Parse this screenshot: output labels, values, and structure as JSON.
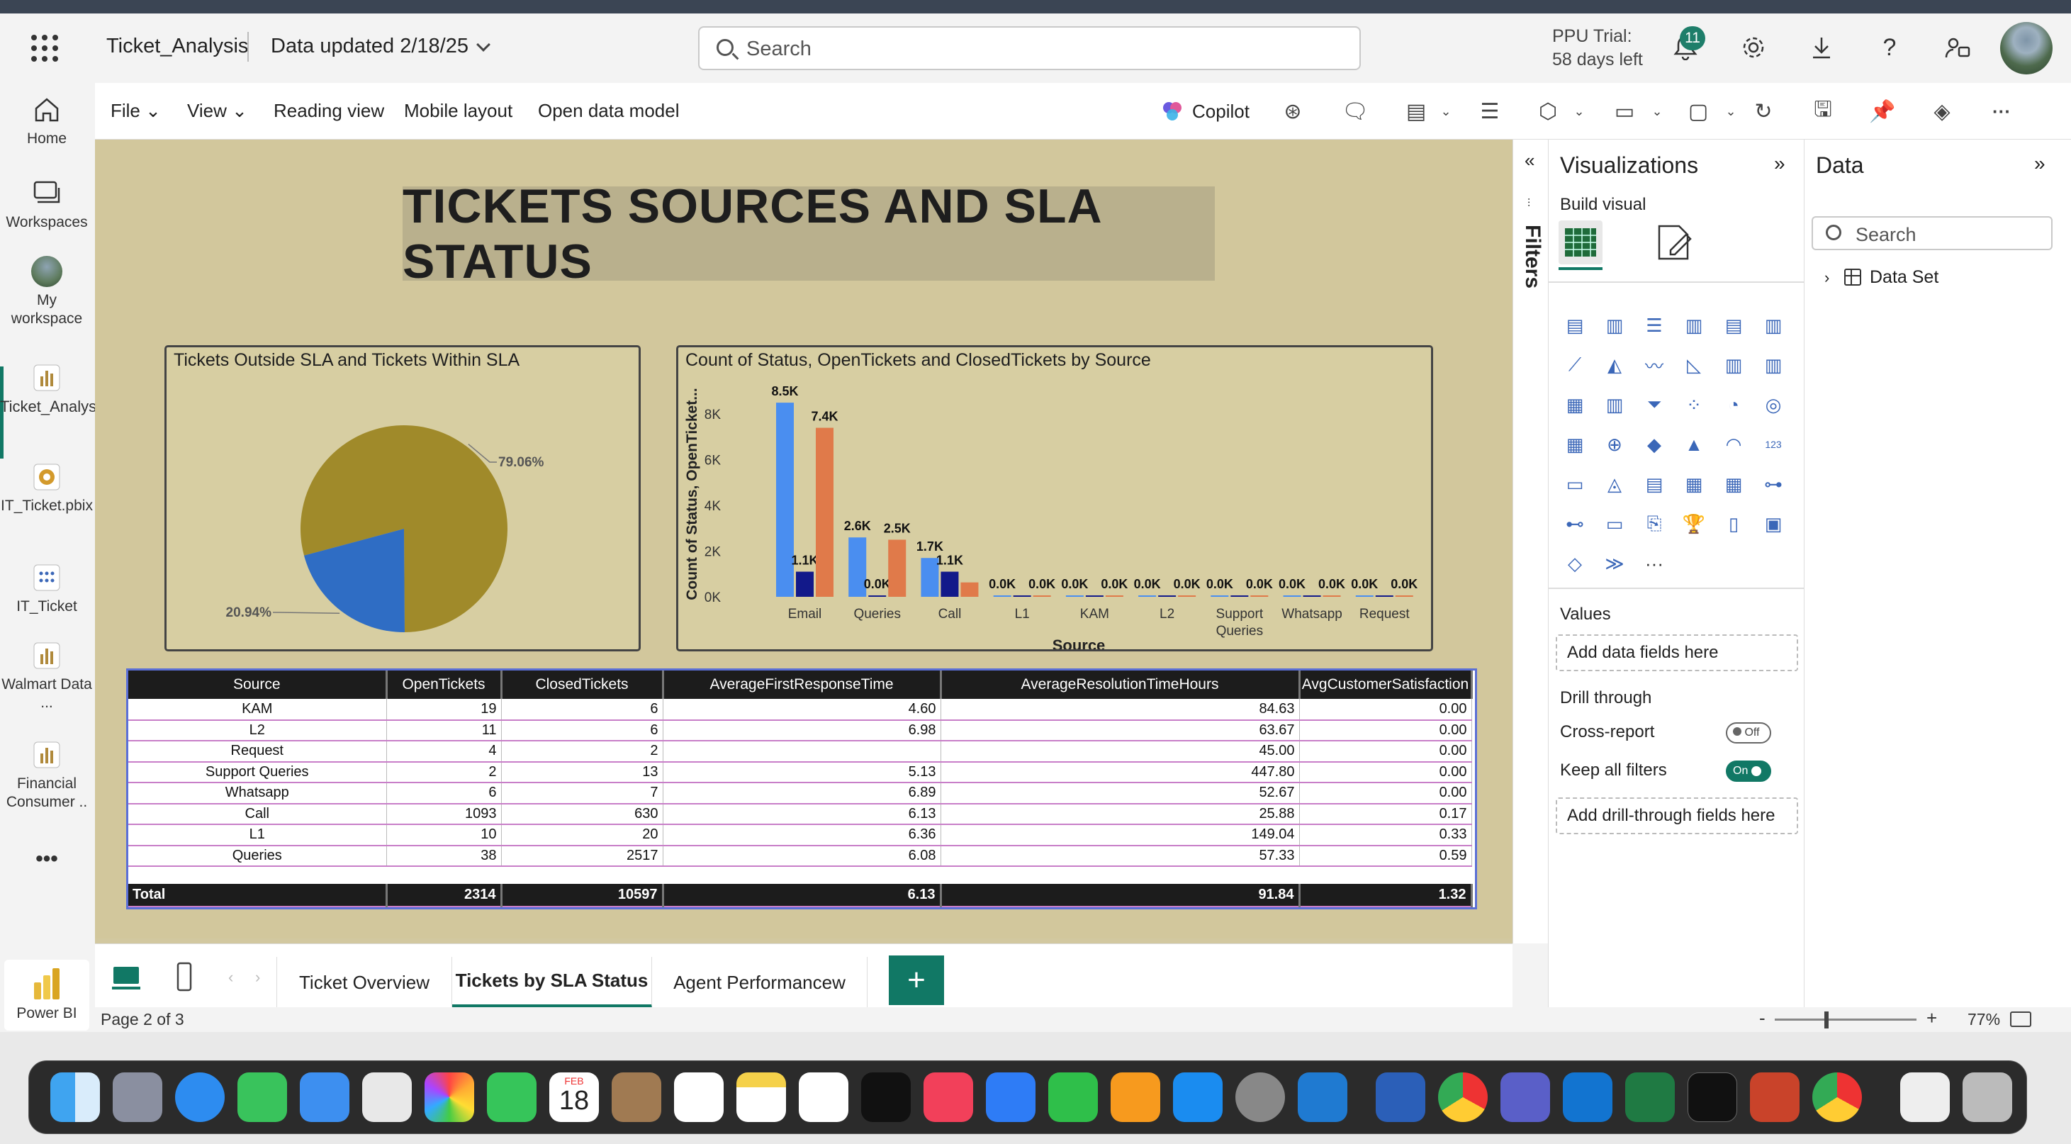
{
  "topbar": {
    "app_title": "Ticket_Analysis",
    "data_updated": "Data updated 2/18/25",
    "search_placeholder": "Search",
    "ppu_line1": "PPU Trial:",
    "ppu_line2": "58 days left",
    "notif_count": "11"
  },
  "leftnav": {
    "items": [
      {
        "label": "Home",
        "icon": "home-icon"
      },
      {
        "label": "Workspaces",
        "icon": "workspaces-icon"
      },
      {
        "label": "My workspace",
        "icon": "avatar"
      },
      {
        "label": "Ticket_Analysis",
        "icon": "report-icon"
      },
      {
        "label": "IT_Ticket.pbix",
        "icon": "pbix-icon"
      },
      {
        "label": "IT_Ticket",
        "icon": "dataset-icon"
      },
      {
        "label": "Walmart Data ...",
        "icon": "report-icon"
      },
      {
        "label": "Financial Consumer ..",
        "icon": "report-icon"
      }
    ],
    "more": "•••",
    "brand": "Power BI"
  },
  "menubar": {
    "file": "File",
    "view": "View",
    "reading_view": "Reading view",
    "mobile_layout": "Mobile layout",
    "open_data_model": "Open data model",
    "copilot": "Copilot"
  },
  "report": {
    "title": "TICKETS SOURCES AND SLA STATUS"
  },
  "chart_data": [
    {
      "type": "pie",
      "title": "Tickets Outside SLA and Tickets Within SLA",
      "slices": [
        {
          "value": 79.06,
          "label": "79.06%",
          "color": "#a08a2a"
        },
        {
          "value": 20.94,
          "label": "20.94%",
          "color": "#2f6dc4"
        }
      ]
    },
    {
      "type": "bar",
      "title": "Count of Status, OpenTickets and ClosedTickets by Source",
      "xlabel": "Source",
      "ylabel": "Count of Status, OpenTicket...",
      "ylim": [
        0,
        9000
      ],
      "yticks": [
        "0K",
        "2K",
        "4K",
        "6K",
        "8K"
      ],
      "categories": [
        "Email",
        "Queries",
        "Call",
        "L1",
        "KAM",
        "L2",
        "Support Queries",
        "Whatsapp",
        "Request"
      ],
      "series": [
        {
          "color": "#4a8ef0",
          "values": [
            8500,
            2600,
            1700,
            30,
            25,
            17,
            15,
            13,
            6
          ],
          "labels": [
            "8.5K",
            "2.6K",
            "1.7K",
            "0.0K",
            "0.0K",
            "0.0K",
            "0.0K",
            "0.0K",
            "0.0K"
          ]
        },
        {
          "color": "#12198a",
          "values": [
            1100,
            38,
            1100,
            10,
            19,
            11,
            2,
            6,
            4
          ],
          "labels": [
            "1.1K",
            "0.0K",
            "1.1K",
            "",
            "",
            "",
            "",
            "",
            ""
          ]
        },
        {
          "color": "#e07a4a",
          "values": [
            7400,
            2500,
            630,
            20,
            6,
            6,
            13,
            7,
            2
          ],
          "labels": [
            "7.4K",
            "2.5K",
            "",
            "0.0K",
            "0.0K",
            "0.0K",
            "0.0K",
            "0.0K",
            "0.0K"
          ]
        }
      ]
    }
  ],
  "table": {
    "headers": [
      "Source",
      "OpenTickets",
      "ClosedTickets",
      "AverageFirstResponseTime",
      "AverageResolutionTimeHours",
      "AvgCustomerSatisfaction"
    ],
    "rows": [
      [
        "KAM",
        "19",
        "6",
        "4.60",
        "84.63",
        "0.00"
      ],
      [
        "L2",
        "11",
        "6",
        "6.98",
        "63.67",
        "0.00"
      ],
      [
        "Request",
        "4",
        "2",
        "",
        "45.00",
        "0.00"
      ],
      [
        "Support Queries",
        "2",
        "13",
        "5.13",
        "447.80",
        "0.00"
      ],
      [
        "Whatsapp",
        "6",
        "7",
        "6.89",
        "52.67",
        "0.00"
      ],
      [
        "Call",
        "1093",
        "630",
        "6.13",
        "25.88",
        "0.17"
      ],
      [
        "L1",
        "10",
        "20",
        "6.36",
        "149.04",
        "0.33"
      ],
      [
        "Queries",
        "38",
        "2517",
        "6.08",
        "57.33",
        "0.59"
      ]
    ],
    "total": [
      "Total",
      "2314",
      "10597",
      "6.13",
      "91.84",
      "1.32"
    ]
  },
  "tabs": {
    "t1": "Ticket Overview",
    "t2": "Tickets by SLA Status",
    "t3": "Agent Performancew"
  },
  "status": {
    "page": "Page 2 of 3",
    "zoom": "77%"
  },
  "filters": {
    "label": "Filters"
  },
  "viz": {
    "title": "Visualizations",
    "build_visual": "Build visual",
    "values": "Values",
    "add_data": "Add data fields here",
    "drill_through": "Drill through",
    "cross_report": "Cross-report",
    "cross_report_state": "Off",
    "keep_filters": "Keep all filters",
    "keep_filters_state": "On",
    "add_drill": "Add drill-through fields here",
    "more": "···"
  },
  "datapane": {
    "title": "Data",
    "search_placeholder": "Search",
    "dataset": "Data Set"
  },
  "dock": {
    "calendar_month": "FEB",
    "calendar_day": "18"
  }
}
